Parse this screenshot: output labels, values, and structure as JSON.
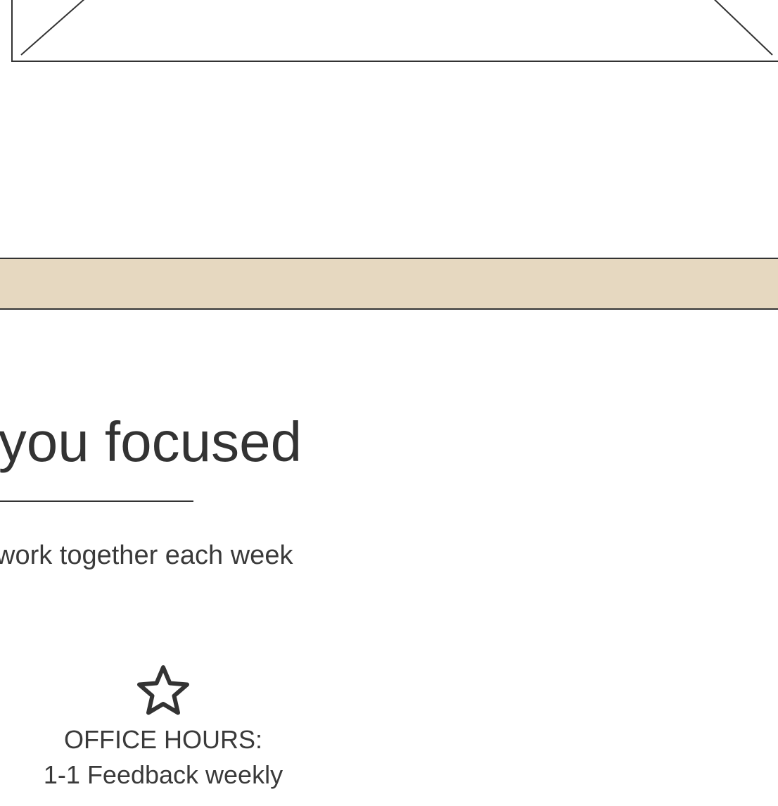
{
  "heading": "keeps you focused",
  "subtitle": "work together each week",
  "feature": {
    "icon": "star-icon",
    "title": "OFFICE HOURS:",
    "description": "1-1 Feedback weekly"
  },
  "colors": {
    "band": "#e6d8c0",
    "text": "#333333",
    "stroke": "#333333",
    "background": "#ffffff"
  }
}
